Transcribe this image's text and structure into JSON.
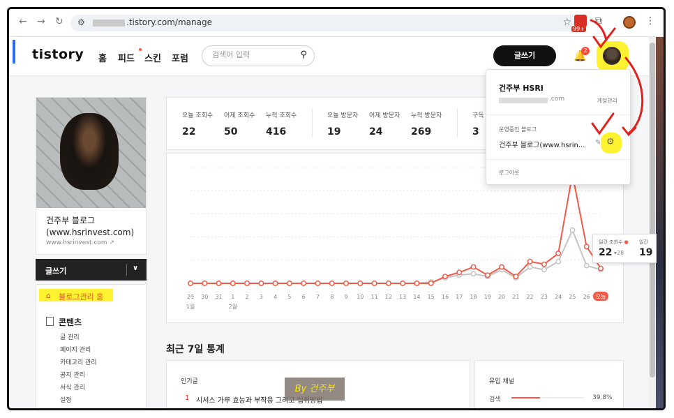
{
  "browser": {
    "url": ".tistory.com/manage",
    "ext_badge": "99+"
  },
  "header": {
    "logo": "tistory",
    "nav": [
      "홈",
      "피드",
      "스킨",
      "포럼"
    ],
    "search_placeholder": "검색어 입력",
    "write_label": "글쓰기",
    "notif_count": "2"
  },
  "profile_menu": {
    "name": "건주부 HSRI",
    "email_suffix": ".com",
    "account_label": "계정관리",
    "running_label": "운영중인 블로그",
    "blog_name": "건주부 블로그(www.hsrin...",
    "logout_label": "로그아웃"
  },
  "sidebar": {
    "blog_name": "건주부 블로그\n(www.hsrinvest.com)",
    "blog_url": "www.hsrinvest.com",
    "write_label": "글쓰기",
    "home_label": "블로그관리 홈",
    "content_label": "콘텐츠",
    "content_items": [
      "글 관리",
      "페이지 관리",
      "카테고리 관리",
      "공지 관리",
      "서식 관리",
      "설정"
    ]
  },
  "stats": [
    {
      "label": "오늘 조회수",
      "value": "22"
    },
    {
      "label": "어제 조회수",
      "value": "50"
    },
    {
      "label": "누적 조회수",
      "value": "416"
    },
    {
      "label": "오늘 방문자",
      "value": "19"
    },
    {
      "label": "어제 방문자",
      "value": "24"
    },
    {
      "label": "누적 방문자",
      "value": "269"
    },
    {
      "label": "구독",
      "value": "3"
    }
  ],
  "chart_data": {
    "type": "line",
    "x": [
      "29",
      "30",
      "31",
      "1",
      "2",
      "3",
      "4",
      "5",
      "6",
      "7",
      "8",
      "9",
      "10",
      "11",
      "12",
      "13",
      "14",
      "15",
      "16",
      "17",
      "18",
      "19",
      "20",
      "21",
      "22",
      "23",
      "24",
      "25",
      "26",
      "오늘"
    ],
    "month_labels": [
      {
        "index": 0,
        "label": "1월"
      },
      {
        "index": 3,
        "label": "2월"
      }
    ],
    "series": [
      {
        "name": "일간 조회수",
        "color": "#f05a47",
        "values": [
          0,
          0,
          0,
          0,
          0,
          0,
          0,
          0,
          0,
          0,
          0,
          0,
          0,
          0,
          0,
          0,
          0,
          0,
          5,
          8,
          12,
          6,
          12,
          5,
          16,
          14,
          22,
          80,
          27,
          11
        ]
      },
      {
        "name": "일간 방문자",
        "color": "#c4c4c4",
        "values": [
          0,
          0,
          0,
          0,
          0,
          0,
          0,
          0,
          0,
          0,
          0,
          0,
          0,
          0,
          0,
          0,
          0,
          1,
          4,
          6,
          7,
          5,
          10,
          4,
          12,
          10,
          16,
          39,
          13,
          10
        ]
      }
    ],
    "ylim": [
      0,
      85
    ],
    "tooltip": {
      "label1": "일간 조회수",
      "value1": "22",
      "delta1": "▾28",
      "label2": "일간",
      "value2": "19"
    }
  },
  "recent": {
    "title": "최근 7일 통계",
    "popular_label": "인기글",
    "popular_items": [
      {
        "rank": "1",
        "title": "시서스 가루 효능과 부작용 그리고 섭취방법"
      }
    ],
    "channel_label": "유입 채널",
    "channels": [
      {
        "name": "검색",
        "percent": "39.8%",
        "ratio": 0.398
      }
    ]
  },
  "watermark": "By 건주부"
}
